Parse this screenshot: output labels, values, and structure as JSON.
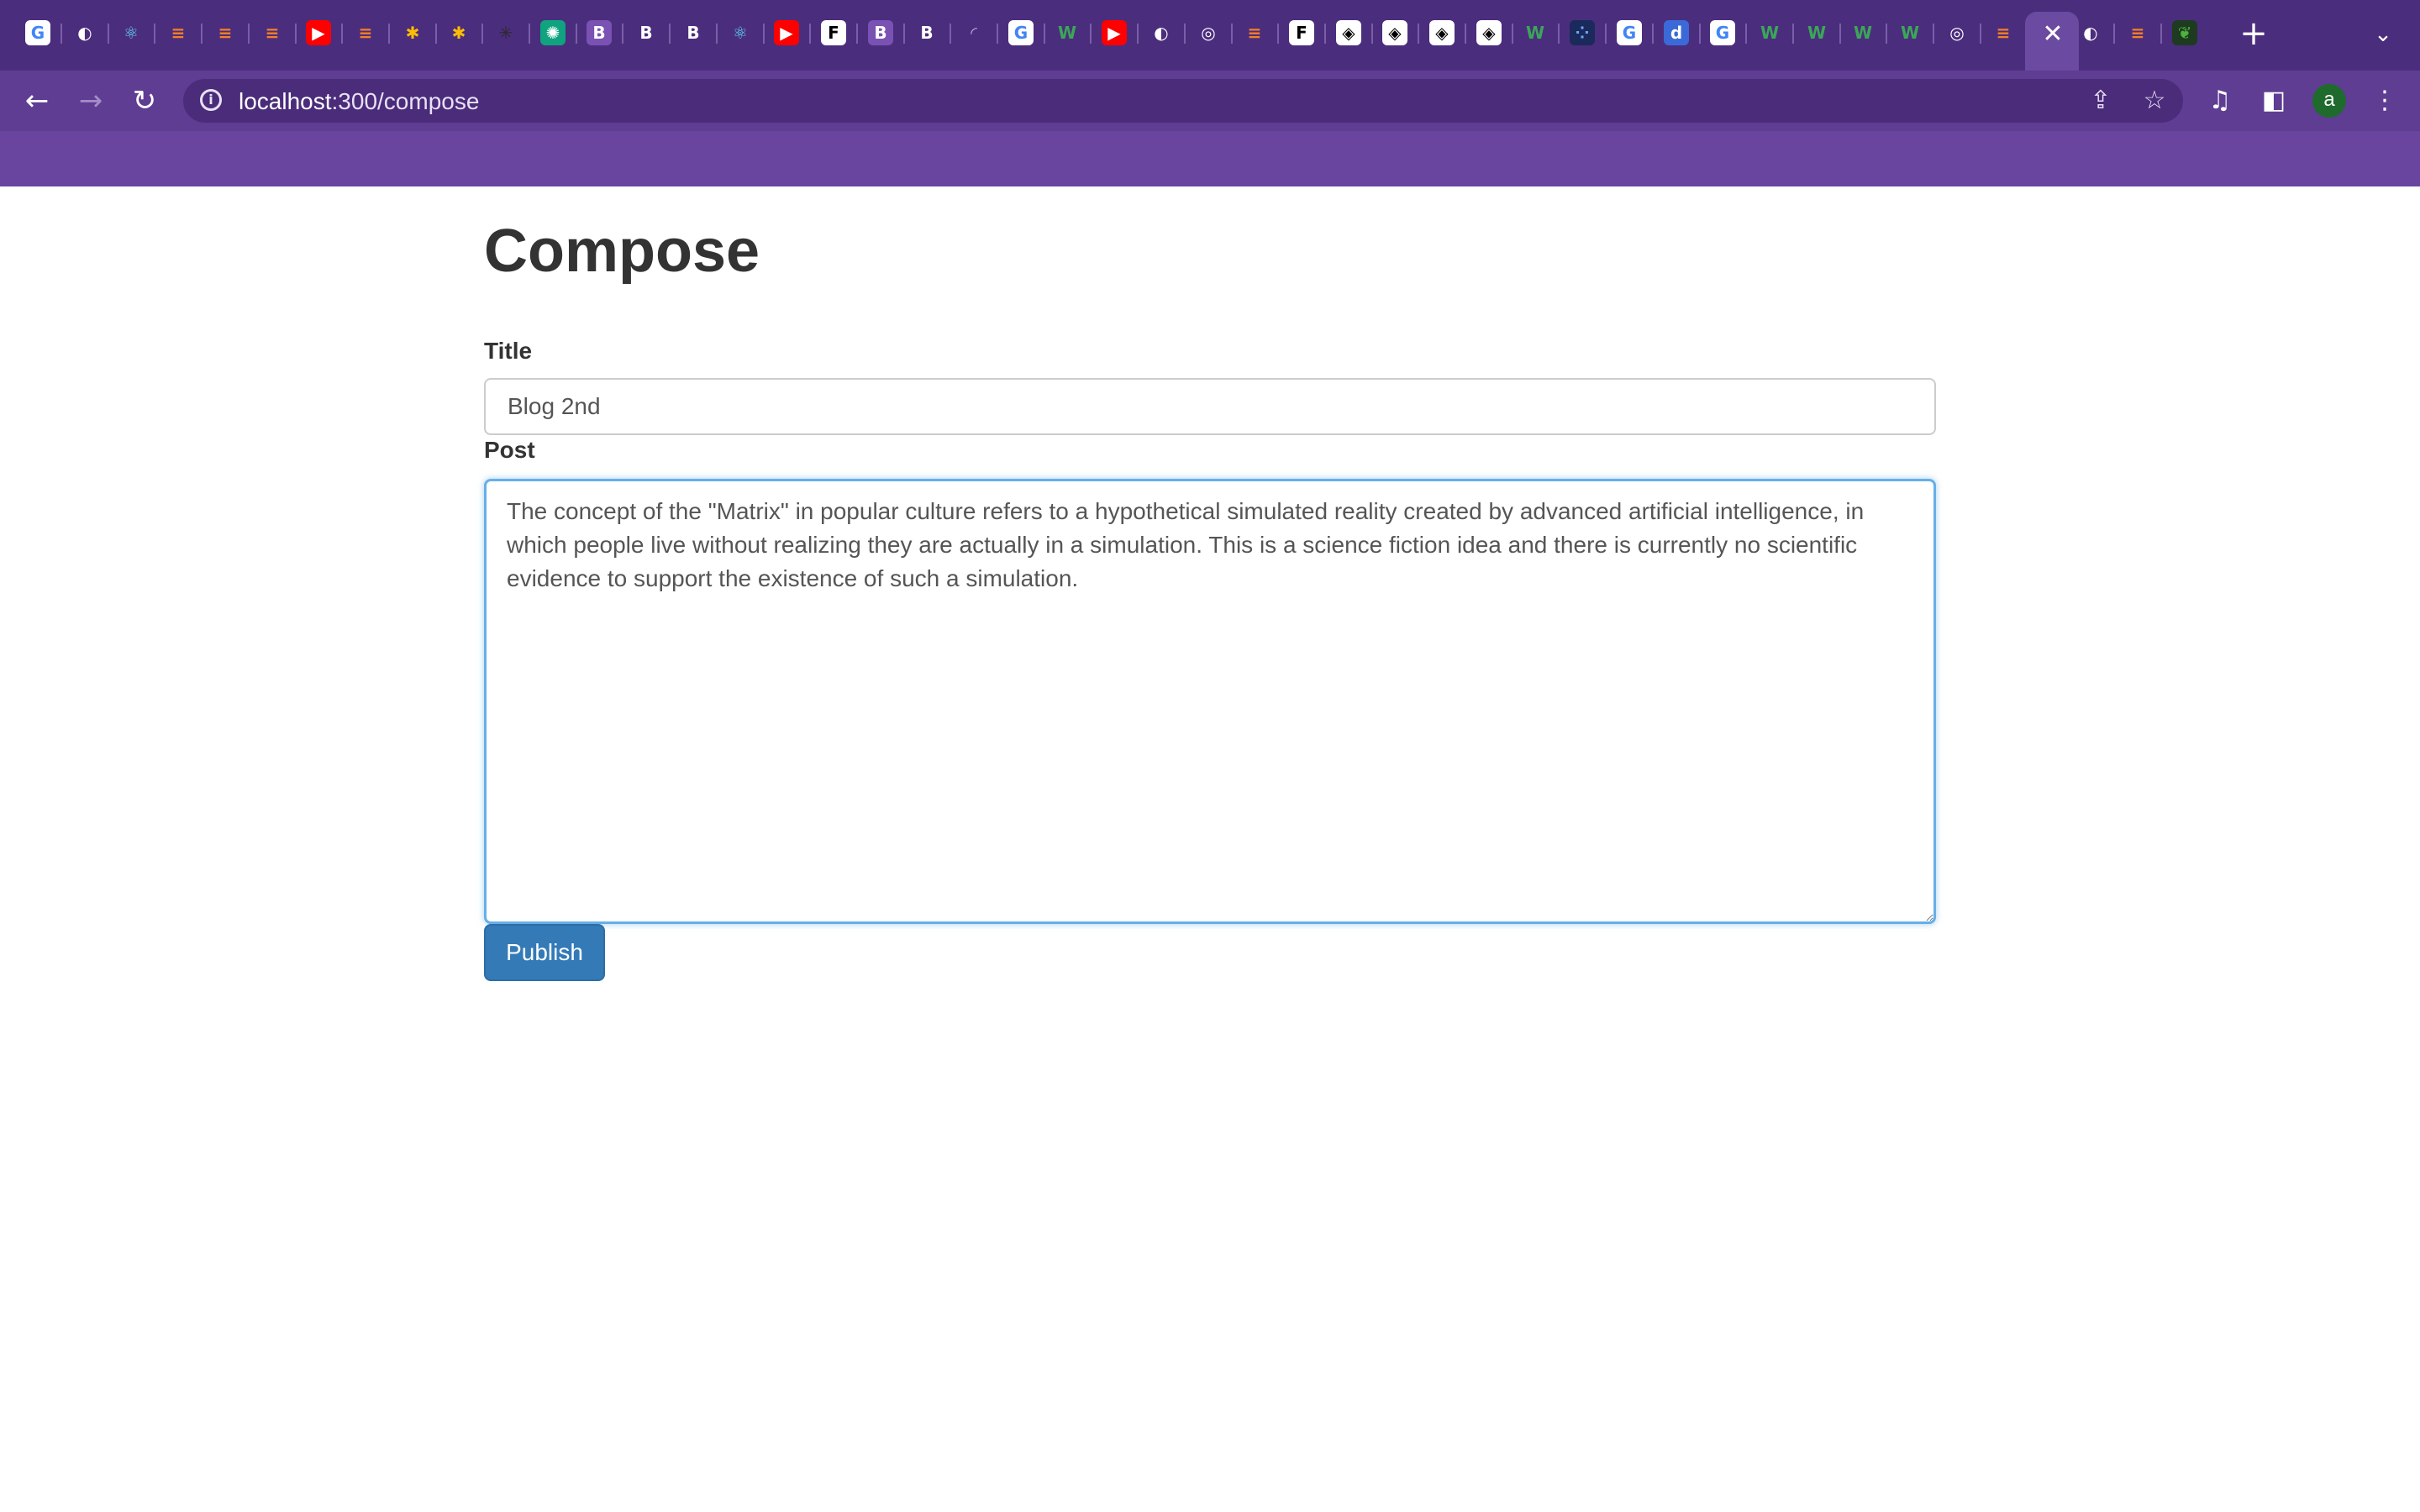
{
  "browser": {
    "url_host": "localhost",
    "url_path": ":300/compose",
    "active_tab_close_glyph": "✕",
    "new_tab_glyph": "+",
    "tab_search_glyph": "⌄",
    "back_glyph": "←",
    "forward_glyph": "→",
    "reload_glyph": "↻",
    "info_glyph": "i",
    "share_glyph": "⇪",
    "bookmark_glyph": "☆",
    "media_glyph": "♫",
    "sidepanel_glyph": "◧",
    "menu_glyph": "⋮",
    "profile_initial": "a",
    "tabs": [
      {
        "icon": "google-icon",
        "glyph": "G",
        "bg": "#ffffff",
        "fg": "#4285f4"
      },
      {
        "icon": "globe-icon",
        "glyph": "◐",
        "bg": "#4b2d7d",
        "fg": "#ffffff"
      },
      {
        "icon": "react-icon",
        "glyph": "⚛",
        "bg": "#4b2d7d",
        "fg": "#61dafb"
      },
      {
        "icon": "stackoverflow-icon",
        "glyph": "≡",
        "bg": "#4b2d7d",
        "fg": "#f48024"
      },
      {
        "icon": "stackoverflow-icon",
        "glyph": "≡",
        "bg": "#4b2d7d",
        "fg": "#f48024"
      },
      {
        "icon": "stackoverflow-icon",
        "glyph": "≡",
        "bg": "#4b2d7d",
        "fg": "#f48024"
      },
      {
        "icon": "youtube-icon",
        "glyph": "▶",
        "bg": "#ff0000",
        "fg": "#ffffff"
      },
      {
        "icon": "stackoverflow-icon",
        "glyph": "≡",
        "bg": "#4b2d7d",
        "fg": "#f48024"
      },
      {
        "icon": "multicolor-icon",
        "glyph": "✱",
        "bg": "#4b2d7d",
        "fg": "#fbbc05"
      },
      {
        "icon": "multicolor-icon",
        "glyph": "✱",
        "bg": "#4b2d7d",
        "fg": "#fbbc05"
      },
      {
        "icon": "dark-icon",
        "glyph": "✳",
        "bg": "#4b2d7d",
        "fg": "#2a2a2a"
      },
      {
        "icon": "chatgpt-icon",
        "glyph": "✺",
        "bg": "#10a37f",
        "fg": "#ffffff"
      },
      {
        "icon": "bootstrap-icon",
        "glyph": "B",
        "bg": "#7952b3",
        "fg": "#ffffff"
      },
      {
        "icon": "bold-b-icon",
        "glyph": "B",
        "bg": "#4b2d7d",
        "fg": "#ffffff"
      },
      {
        "icon": "bold-b-icon",
        "glyph": "B",
        "bg": "#4b2d7d",
        "fg": "#ffffff"
      },
      {
        "icon": "react-icon",
        "glyph": "⚛",
        "bg": "#4b2d7d",
        "fg": "#61dafb"
      },
      {
        "icon": "youtube-icon",
        "glyph": "▶",
        "bg": "#ff0000",
        "fg": "#ffffff"
      },
      {
        "icon": "frontend-f-icon",
        "glyph": "F",
        "bg": "#ffffff",
        "fg": "#000000"
      },
      {
        "icon": "bootstrap-icon",
        "glyph": "B",
        "bg": "#7952b3",
        "fg": "#ffffff"
      },
      {
        "icon": "bold-b-icon",
        "glyph": "B",
        "bg": "#4b2d7d",
        "fg": "#ffffff"
      },
      {
        "icon": "loading-icon",
        "glyph": "◜",
        "bg": "#4b2d7d",
        "fg": "#b9a7dd"
      },
      {
        "icon": "google-icon",
        "glyph": "G",
        "bg": "#ffffff",
        "fg": "#4285f4"
      },
      {
        "icon": "w-icon",
        "glyph": "W",
        "bg": "#4b2d7d",
        "fg": "#3aa757"
      },
      {
        "icon": "youtube-icon",
        "glyph": "▶",
        "bg": "#ff0000",
        "fg": "#ffffff"
      },
      {
        "icon": "globe-icon",
        "glyph": "◐",
        "bg": "#4b2d7d",
        "fg": "#ffffff"
      },
      {
        "icon": "chrome-icon",
        "glyph": "◎",
        "bg": "#4b2d7d",
        "fg": "#ffffff"
      },
      {
        "icon": "stackoverflow-icon",
        "glyph": "≡",
        "bg": "#4b2d7d",
        "fg": "#f48024"
      },
      {
        "icon": "frontend-f-icon",
        "glyph": "F",
        "bg": "#ffffff",
        "fg": "#000000"
      },
      {
        "icon": "codepen-icon",
        "glyph": "◈",
        "bg": "#ffffff",
        "fg": "#000000"
      },
      {
        "icon": "codepen-icon",
        "glyph": "◈",
        "bg": "#ffffff",
        "fg": "#000000"
      },
      {
        "icon": "codepen-icon",
        "glyph": "◈",
        "bg": "#ffffff",
        "fg": "#000000"
      },
      {
        "icon": "codepen-icon",
        "glyph": "◈",
        "bg": "#ffffff",
        "fg": "#000000"
      },
      {
        "icon": "w-icon",
        "glyph": "W",
        "bg": "#4b2d7d",
        "fg": "#3aa757"
      },
      {
        "icon": "dotted-icon",
        "glyph": "⁘",
        "bg": "#1a2a5a",
        "fg": "#6fa8ff"
      },
      {
        "icon": "google-icon",
        "glyph": "G",
        "bg": "#ffffff",
        "fg": "#4285f4"
      },
      {
        "icon": "d-icon",
        "glyph": "d",
        "bg": "#3b6ad8",
        "fg": "#ffffff"
      },
      {
        "icon": "google-icon",
        "glyph": "G",
        "bg": "#ffffff",
        "fg": "#4285f4"
      },
      {
        "icon": "w-icon",
        "glyph": "W",
        "bg": "#4b2d7d",
        "fg": "#3aa757"
      },
      {
        "icon": "w-icon",
        "glyph": "W",
        "bg": "#4b2d7d",
        "fg": "#3aa757"
      },
      {
        "icon": "w-icon",
        "glyph": "W",
        "bg": "#4b2d7d",
        "fg": "#3aa757"
      },
      {
        "icon": "w-icon",
        "glyph": "W",
        "bg": "#4b2d7d",
        "fg": "#3aa757"
      },
      {
        "icon": "chrome-icon",
        "glyph": "◎",
        "bg": "#4b2d7d",
        "fg": "#ffffff"
      },
      {
        "icon": "stackoverflow-icon",
        "glyph": "≡",
        "bg": "#4b2d7d",
        "fg": "#f48024"
      },
      {
        "icon": "globe-icon",
        "glyph": "◐",
        "bg": "#4b2d7d",
        "fg": "#ffffff"
      },
      {
        "icon": "stackoverflow-icon",
        "glyph": "≡",
        "bg": "#4b2d7d",
        "fg": "#f48024"
      },
      {
        "icon": "mongodb-leaf-icon",
        "glyph": "❦",
        "bg": "#1e3a20",
        "fg": "#4db33d"
      }
    ]
  },
  "page": {
    "heading": "Compose",
    "title_label": "Title",
    "title_value": "Blog 2nd",
    "post_label": "Post",
    "post_value": "The concept of the \"Matrix\" in popular culture refers to a hypothetical simulated reality created by advanced artificial intelligence, in which people live without realizing they are actually in a simulation. This is a science fiction idea and there is currently no scientific evidence to support the existence of such a simulation.",
    "publish_label": "Publish"
  },
  "colors": {
    "tabstrip": "#4b2d7d",
    "toolbar": "#6a45a0",
    "primary_button": "#337ab7",
    "focus_border": "#66afe9"
  }
}
